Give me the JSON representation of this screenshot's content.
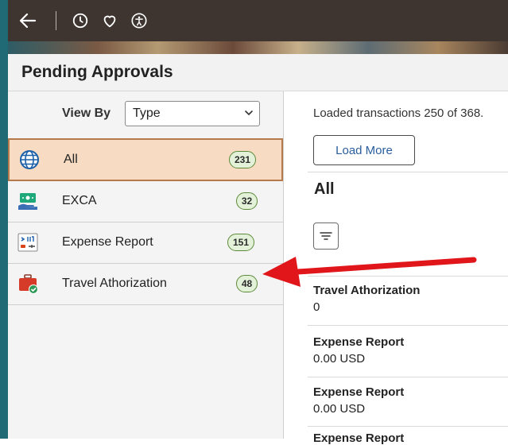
{
  "topbar": {
    "icons": [
      "back-arrow-icon",
      "history-clock-icon",
      "favorites-heart-icon",
      "accessibility-icon"
    ]
  },
  "header": {
    "title": "Pending Approvals"
  },
  "filter": {
    "label": "View By",
    "selected": "Type"
  },
  "categories": [
    {
      "label": "All",
      "count": "231",
      "icon": "globe-icon",
      "active": true
    },
    {
      "label": "EXCA",
      "count": "32",
      "icon": "cash-payment-icon",
      "active": false
    },
    {
      "label": "Expense Report",
      "count": "151",
      "icon": "expense-report-icon",
      "active": false
    },
    {
      "label": "Travel Athorization",
      "count": "48",
      "icon": "travel-suitcase-icon",
      "active": false
    }
  ],
  "right": {
    "loaded_text": "Loaded transactions 250 of 368.",
    "load_more": "Load More",
    "section_title": "All",
    "transactions": [
      {
        "title": "Travel Athorization",
        "amount": "0"
      },
      {
        "title": "Expense Report",
        "amount": "0.00  USD"
      },
      {
        "title": "Expense Report",
        "amount": "0.00  USD"
      },
      {
        "title": "Expense Report",
        "amount": ""
      }
    ]
  },
  "colors": {
    "active_row_bg": "#f7dcc3",
    "active_row_border": "#b47a4c",
    "badge_bg": "#e3f1d9",
    "badge_border": "#5d8a3a",
    "link_blue": "#2a5d9c",
    "annotation_arrow": "#e0161b"
  }
}
